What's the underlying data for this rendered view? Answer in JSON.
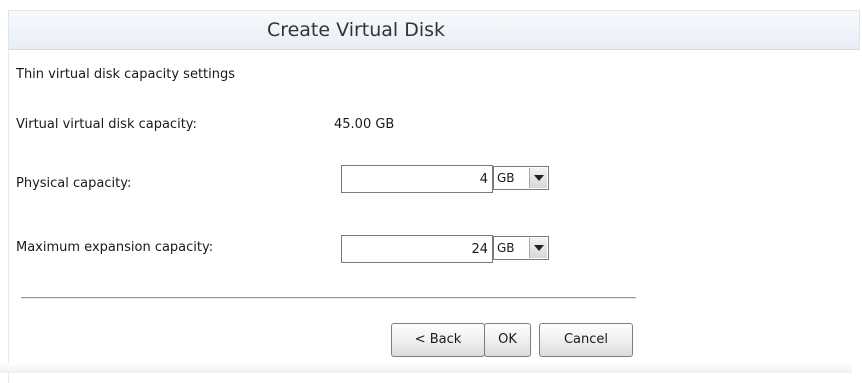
{
  "dialog": {
    "title": "Create Virtual Disk",
    "section_title": "Thin virtual disk capacity settings"
  },
  "fields": {
    "virtual_capacity": {
      "label": "Virtual virtual disk capacity:",
      "value": "45.00 GB"
    },
    "physical_capacity": {
      "label": "Physical capacity:",
      "value": "4",
      "unit": "GB"
    },
    "max_expansion_capacity": {
      "label": "Maximum expansion capacity:",
      "value": "24",
      "unit": "GB"
    }
  },
  "buttons": {
    "back": "< Back",
    "ok": "OK",
    "cancel": "Cancel"
  },
  "colors": {
    "titlebar_top": "#f7f9fc",
    "titlebar_bottom": "#e9eef6",
    "text": "#1a1a1a"
  }
}
